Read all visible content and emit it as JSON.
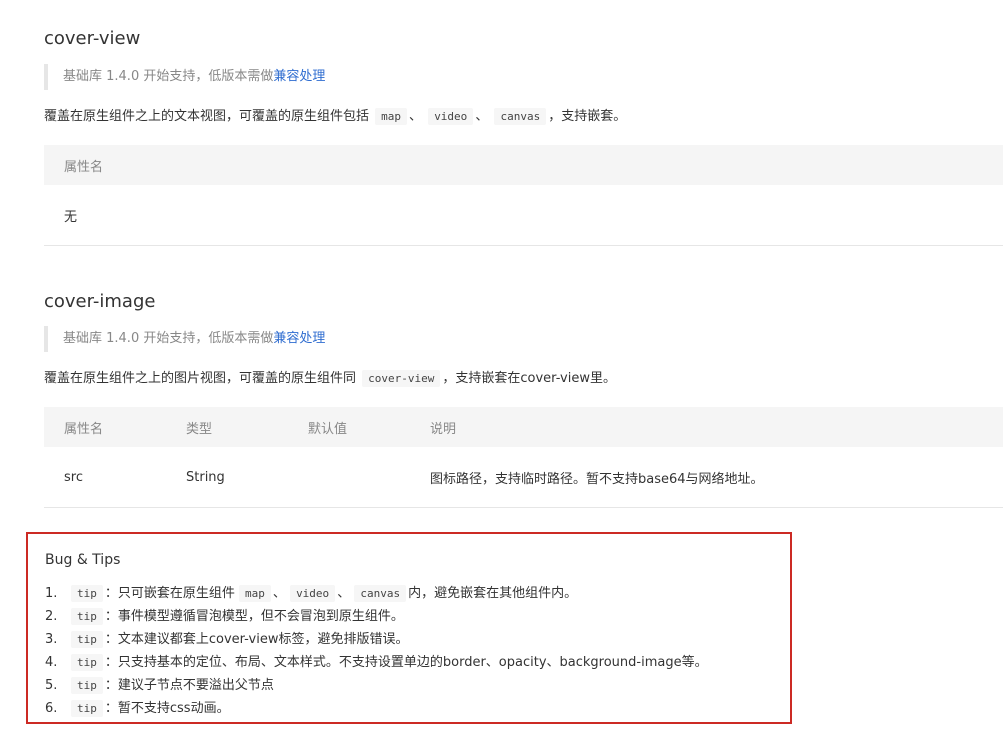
{
  "section1": {
    "title": "cover-view",
    "note_prefix": "基础库 1.4.0 开始支持，低版本需做",
    "note_link": "兼容处理",
    "desc_text1": "覆盖在原生组件之上的文本视图，可覆盖的原生组件包括",
    "code1": "map",
    "sep1": "、",
    "code2": "video",
    "sep2": "、",
    "code3": "canvas",
    "desc_text2": "，支持嵌套。",
    "table_header": "属性名",
    "table_value": "无"
  },
  "section2": {
    "title": "cover-image",
    "note_prefix": "基础库 1.4.0 开始支持，低版本需做",
    "note_link": "兼容处理",
    "desc_text1": "覆盖在原生组件之上的图片视图，可覆盖的原生组件同",
    "code1": "cover-view",
    "desc_text2": "，支持嵌套在cover-view里。",
    "headers": [
      "属性名",
      "类型",
      "默认值",
      "说明"
    ],
    "row": [
      "src",
      "String",
      "",
      "图标路径，支持临时路径。暂不支持base64与网络地址。"
    ]
  },
  "tips": {
    "title": "Bug & Tips",
    "items": [
      {
        "num": "1.",
        "code": "tip",
        "text_a": "：只可嵌套在原生组件",
        "code_a": "map",
        "sep_a": "、",
        "code_b": "video",
        "sep_b": "、",
        "code_c": "canvas",
        "text_b": "内，避免嵌套在其他组件内。"
      },
      {
        "num": "2.",
        "code": "tip",
        "text": "：事件模型遵循冒泡模型，但不会冒泡到原生组件。"
      },
      {
        "num": "3.",
        "code": "tip",
        "text": "：文本建议都套上cover-view标签，避免排版错误。"
      },
      {
        "num": "4.",
        "code": "tip",
        "text": "：只支持基本的定位、布局、文本样式。不支持设置单边的border、opacity、background-image等。"
      },
      {
        "num": "5.",
        "code": "tip",
        "text": "：建议子节点不要溢出父节点"
      },
      {
        "num": "6.",
        "code": "tip",
        "text": "：暂不支持css动画。"
      }
    ]
  },
  "colors": {
    "link": "#2f6dd0",
    "tips_border": "#cc2a24",
    "table_header_bg": "#f5f5f5"
  }
}
